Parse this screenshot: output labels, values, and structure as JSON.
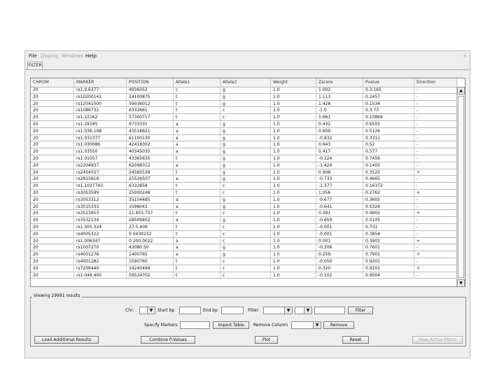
{
  "menu": [
    {
      "label": "File",
      "enabled": true
    },
    {
      "label": "Display",
      "enabled": false
    },
    {
      "label": "Windows",
      "enabled": false
    },
    {
      "label": "Help",
      "enabled": true
    }
  ],
  "tab": {
    "label": "FILTER"
  },
  "table": {
    "columns": [
      "CHROM",
      "MARKER",
      "POSITION",
      "Allele1",
      "Allele2",
      "Weight",
      "Zscore",
      "Pvalue",
      "Direction"
    ],
    "rows": [
      [
        "20",
        "rs1.0.6377",
        "4936052",
        "c",
        "g",
        "1.0",
        "1.002",
        "0.3.165",
        "-"
      ],
      [
        "20",
        "rs10200141",
        "24100875",
        "t",
        "g",
        "1.0",
        "1.113",
        "0.2457",
        "-"
      ],
      [
        "20",
        "rs12041000",
        "59036012",
        "t",
        "g",
        "1.0",
        "1.428",
        "0.1534",
        "-"
      ],
      [
        "20",
        "rs1086732",
        "6332661",
        "t",
        "c",
        "1.0",
        "-1.0",
        "0.3.73",
        "-"
      ],
      [
        "20",
        "rs1.22162",
        "57300717",
        "t",
        "c",
        "1.0",
        "1.661",
        "0.10869",
        "-"
      ],
      [
        "20",
        "rs1.29185",
        "6733331",
        "a",
        "g",
        "1.0",
        "0.432",
        "0.6555",
        "-"
      ],
      [
        "20",
        "rs1.036.108",
        "43518621",
        "a",
        "g",
        "1.0",
        "0.609",
        "0.5126",
        "-"
      ],
      [
        "20",
        "rs1.031377",
        "61100130",
        "a",
        "g",
        "1.0",
        "-0.832",
        "0.3311",
        "-"
      ],
      [
        "20",
        "rs1.030086",
        "42418302",
        "a",
        "g",
        "1.0",
        "0.643",
        "0.52",
        "-"
      ],
      [
        "20",
        "rs1.03550",
        "40345035",
        "a",
        "g",
        "1.0",
        "0.417",
        "0.577",
        "-"
      ],
      [
        "20",
        "rs1.01057",
        "43365635",
        "t",
        "g",
        "1.0",
        "-0.324",
        "0.7456",
        "-"
      ],
      [
        "20",
        "rs2204937",
        "62098312",
        "a",
        "g",
        "1.0",
        "-1.424",
        "0.1405",
        "-"
      ],
      [
        "20",
        "rs2454557",
        "24585539",
        "t",
        "g",
        "1.0",
        "0.908",
        "0.3525",
        "+"
      ],
      [
        "20",
        "rs2815816",
        "25526507",
        "a",
        "g",
        "1.0",
        "-0.733",
        "0.4665",
        "-"
      ],
      [
        "20",
        "rs1.1027743",
        "6332858",
        "t",
        "c",
        "1.0",
        "-1.377",
        "0.16372",
        "-"
      ],
      [
        "20",
        "rs3053599",
        "25000248",
        "t",
        "c",
        "1.0",
        "1.056",
        "0.2762",
        "+"
      ],
      [
        "20",
        "rs3053312",
        "35154485",
        "a",
        "g",
        "1.0",
        "-0.677",
        "0.3605",
        "-"
      ],
      [
        "20",
        "rs3515333",
        "1598043",
        "a",
        "g",
        "1.0",
        "-0.641",
        "0.5324",
        "-"
      ],
      [
        "20",
        "rs3523953",
        "21.953.757",
        "t",
        "c",
        "1.0",
        "0.391",
        "0.4902",
        "+"
      ],
      [
        "20",
        "rs3532134",
        "28509402",
        "a",
        "g",
        "1.0",
        "-0.659",
        "0.5105",
        "-"
      ],
      [
        "20",
        "rs1.005.324",
        "27.5.409",
        "t",
        "c",
        "1.0",
        "-0.001",
        "0.731",
        "-"
      ],
      [
        "20",
        "rs4005322",
        "0.0430232",
        "t",
        "c",
        "1.0",
        "-0.001",
        "0.3854",
        "-"
      ],
      [
        "20",
        "rs1.006347",
        "0.200.0022",
        "a",
        "c",
        "1.0",
        "0.001",
        "0.3902",
        "+"
      ],
      [
        "20",
        "rs1007270",
        "43080.50",
        "a",
        "g",
        "1.0",
        "-0.306",
        "0.7601",
        "-"
      ],
      [
        "20",
        "rs4001276",
        "1400765",
        "a",
        "g",
        "1.0",
        "0.259",
        "0.7901",
        "+"
      ],
      [
        "20",
        "rs4001282",
        "1590765",
        "t",
        "c",
        "1.0",
        "-0.050",
        "0.9201",
        "-"
      ],
      [
        "20",
        "rs7209440",
        "19240499",
        "t",
        "c",
        "1.0",
        "0.320",
        "0.9201",
        "+"
      ],
      [
        "20",
        "rs1.046.400",
        "59524702",
        "t",
        "c",
        "1.0",
        "-0.102",
        "0.9004",
        "-"
      ]
    ]
  },
  "results": {
    "title": "Viewing 29991 results"
  },
  "filters": {
    "chr_label": "Chr:",
    "start_label": "Start bp",
    "end_label": "End bp",
    "filter_label": "Filter:",
    "filter_button": "Filter",
    "specify_markers_label": "Specify Markers",
    "import_table_button": "Import Table",
    "remove_column_label": "Remove Column",
    "remove_button": "Remove"
  },
  "actions": {
    "load_button": "Load Additional Results",
    "combine_button": "Combine P-Values",
    "plot_button": "Plot",
    "reset_button": "Reset",
    "view_filters_button": "View Active Filters"
  }
}
